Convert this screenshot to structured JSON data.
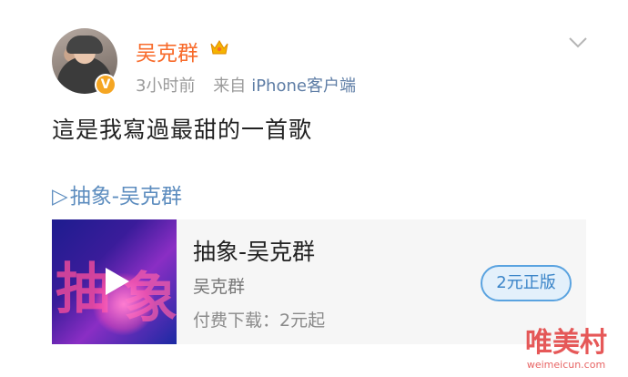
{
  "post": {
    "username": "吴克群",
    "time": "3小时前",
    "source_prefix": "来自",
    "source": "iPhone客户端",
    "text": "這是我寫過最甜的一首歌",
    "badge_icon": "crown-icon",
    "verified_mark": "V"
  },
  "song_link": {
    "play_mark": "▷",
    "label": "抽象-吴克群"
  },
  "music_card": {
    "title": "抽象-吴克群",
    "artist": "吴克群",
    "price_text": "付费下载：2元起",
    "buy_button": "2元正版",
    "cover_glyph_1": "抽",
    "cover_glyph_2": "象"
  },
  "watermark": {
    "name": "唯美村",
    "url": "weimeicun.com"
  },
  "colors": {
    "username": "#f86b2b",
    "link": "#5d8dbf",
    "button_border": "#5aa3e0"
  }
}
